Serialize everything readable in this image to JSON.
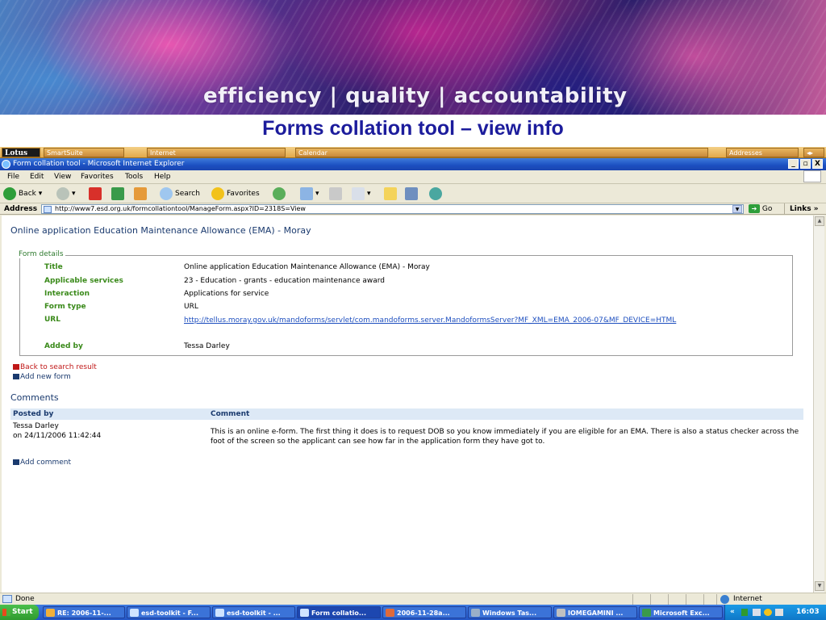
{
  "slide": {
    "banner_text": "efficiency | quality | accountability",
    "title": "Forms collation tool – view info"
  },
  "lotus_bar": {
    "logo": "Lotus",
    "items": [
      "SmartSuite",
      "Internet",
      "Calendar",
      "Addresses"
    ]
  },
  "window": {
    "title": "Form collation tool - Microsoft Internet Explorer",
    "buttons": [
      "_",
      "▫",
      "X"
    ]
  },
  "menu": [
    "File",
    "Edit",
    "View",
    "Favorites",
    "Tools",
    "Help"
  ],
  "toolbar": {
    "back": "Back",
    "search": "Search",
    "favorites": "Favorites"
  },
  "address_bar": {
    "label": "Address",
    "url": "http://www7.esd.org.uk/formcollationtool/ManageForm.aspx?ID=2318S=View",
    "go": "Go",
    "links": "Links"
  },
  "page": {
    "heading": "Online application Education Maintenance Allowance (EMA) - Moray",
    "form_details": {
      "legend": "Form details",
      "rows": [
        {
          "label": "Title",
          "value": "Online application Education Maintenance Allowance (EMA) - Moray"
        },
        {
          "label": "Applicable services",
          "value": "23 - Education - grants - education maintenance award"
        },
        {
          "label": "Interaction",
          "value": "Applications for service"
        },
        {
          "label": "Form type",
          "value": "URL"
        },
        {
          "label": "URL",
          "value": "http://tellus.moray.gov.uk/mandoforms/servlet/com.mandoforms.server.MandoformsServer?MF_XML=EMA_2006-07&MF_DEVICE=HTML"
        },
        {
          "label": "Added by",
          "value": "Tessa Darley"
        }
      ]
    },
    "actions": {
      "back_to_search": "Back to search result",
      "add_new_form": "Add new form"
    },
    "comments": {
      "heading": "Comments",
      "col_posted_by": "Posted by",
      "col_comment": "Comment",
      "rows": [
        {
          "author": "Tessa Darley",
          "date": "on 24/11/2006 11:42:44",
          "comment": "This is an online e-form. The first thing it does is to request DOB so you know immediately if you are eligible for an EMA. There is also a status checker across the foot of the screen so the applicant can see how far in the application form they have got to."
        }
      ],
      "add_comment": "Add comment"
    }
  },
  "status_bar": {
    "status": "Done",
    "zone": "Internet"
  },
  "taskbar": {
    "start": "Start",
    "tasks": [
      "RE: 2006-11-...",
      "esd-toolkit - F...",
      "esd-toolkit - ...",
      "Form collatio...",
      "2006-11-28a...",
      "Windows Tas...",
      "IOMEGAMINI ...",
      "Microsoft Exc..."
    ],
    "clock": "16:03"
  },
  "colors": {
    "slide_title": "#1c1c9c",
    "label_green": "#3a8a1a",
    "heading_blue": "#1a3a6e",
    "link_blue": "#1e4fbf",
    "xp_title_blue": "#1b4fc0"
  }
}
